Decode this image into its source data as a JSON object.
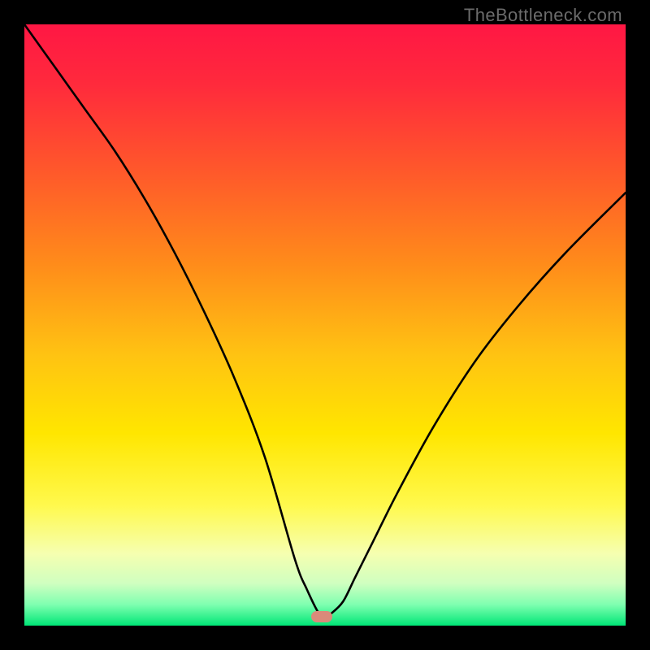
{
  "watermark": "TheBottleneck.com",
  "colors": {
    "frame_bg": "#000000",
    "curve_stroke": "#000000",
    "marker_fill": "#da8a7a",
    "gradient_stops": [
      {
        "offset": 0.0,
        "color": "#ff1744"
      },
      {
        "offset": 0.1,
        "color": "#ff2a3c"
      },
      {
        "offset": 0.25,
        "color": "#ff5a2a"
      },
      {
        "offset": 0.4,
        "color": "#ff8c1a"
      },
      {
        "offset": 0.55,
        "color": "#ffc312"
      },
      {
        "offset": 0.68,
        "color": "#ffe600"
      },
      {
        "offset": 0.8,
        "color": "#fff94d"
      },
      {
        "offset": 0.88,
        "color": "#f6ffb0"
      },
      {
        "offset": 0.93,
        "color": "#cfffc0"
      },
      {
        "offset": 0.965,
        "color": "#7fffb0"
      },
      {
        "offset": 1.0,
        "color": "#00e676"
      }
    ]
  },
  "chart_data": {
    "type": "line",
    "title": "",
    "xlabel": "",
    "ylabel": "",
    "xlim": [
      0,
      100
    ],
    "ylim": [
      0,
      100
    ],
    "grid": false,
    "legend": false,
    "series": [
      {
        "name": "bottleneck-curve",
        "x": [
          0,
          5,
          10,
          15,
          20,
          25,
          30,
          35,
          40,
          45,
          47,
          49,
          50,
          51,
          53,
          55,
          58,
          62,
          68,
          75,
          82,
          90,
          100
        ],
        "y": [
          100,
          93,
          86,
          79,
          71,
          62,
          52,
          41,
          28,
          11,
          6,
          2,
          1.5,
          2,
          4,
          8,
          14,
          22,
          33,
          44,
          53,
          62,
          72
        ]
      }
    ],
    "annotations": [
      {
        "name": "marker-min",
        "x": 49.5,
        "y": 1.5
      }
    ]
  }
}
